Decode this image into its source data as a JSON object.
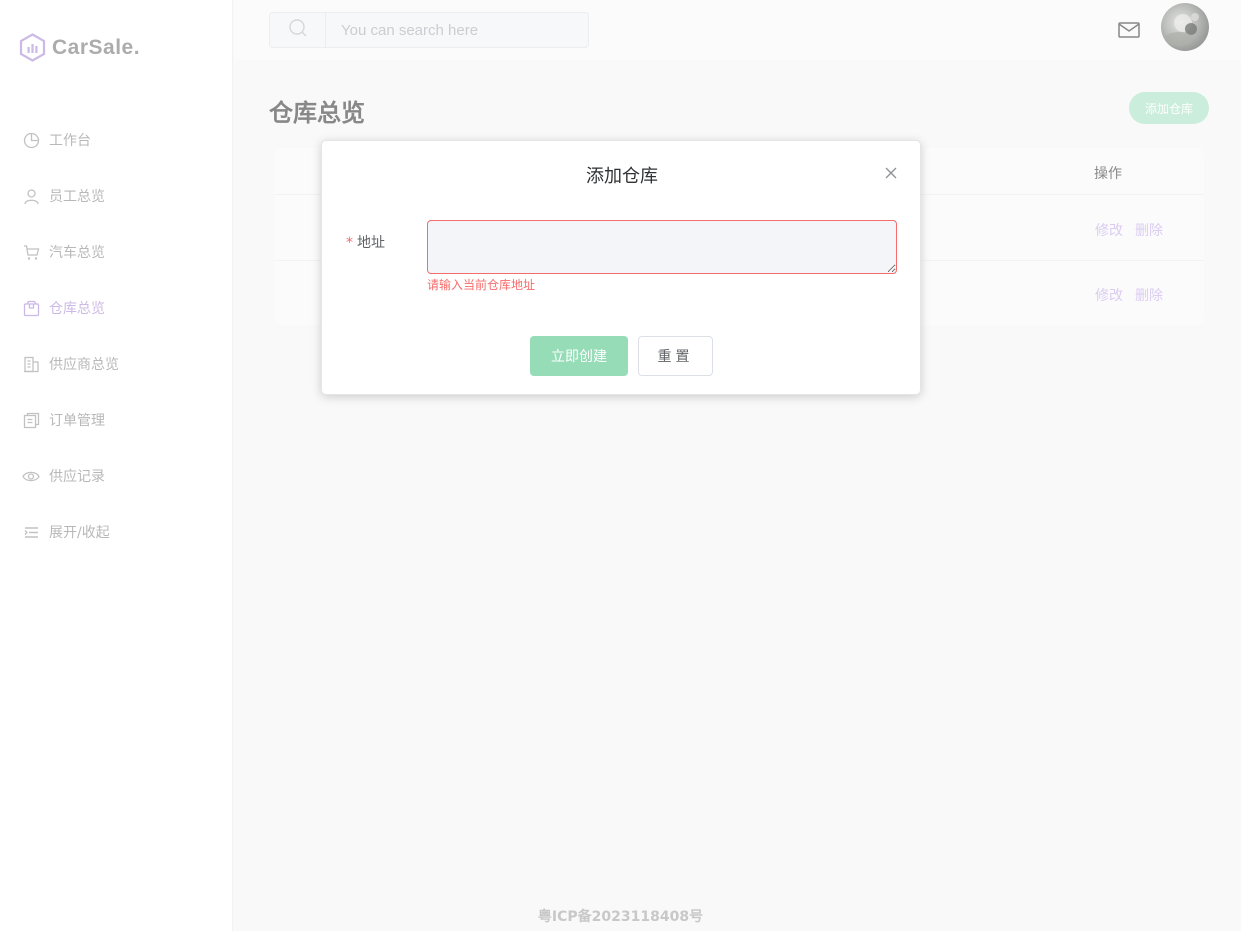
{
  "brand": {
    "name": "CarSale."
  },
  "header": {
    "search_placeholder": "You can search here"
  },
  "sidebar": {
    "items": [
      {
        "label": "工作台",
        "icon": "pie-chart-icon",
        "active": false
      },
      {
        "label": "员工总览",
        "icon": "user-icon",
        "active": false
      },
      {
        "label": "汽车总览",
        "icon": "cart-icon",
        "active": false
      },
      {
        "label": "仓库总览",
        "icon": "box-icon",
        "active": true
      },
      {
        "label": "供应商总览",
        "icon": "building-icon",
        "active": false
      },
      {
        "label": "订单管理",
        "icon": "document-icon",
        "active": false
      },
      {
        "label": "供应记录",
        "icon": "eye-icon",
        "active": false
      },
      {
        "label": "展开/收起",
        "icon": "menu-icon",
        "active": false
      }
    ]
  },
  "main": {
    "title": "仓库总览",
    "add_button": "添加仓库",
    "table": {
      "op_header": "操作",
      "rows": [
        {
          "edit": "修改",
          "delete": "删除"
        },
        {
          "edit": "修改",
          "delete": "删除"
        }
      ]
    }
  },
  "dialog": {
    "title": "添加仓库",
    "field_label": "地址",
    "required_mark": "*",
    "error": "请输入当前仓库地址",
    "create_button": "立即创建",
    "reset_button": "重置"
  },
  "footer": {
    "icp": "粤ICP备2023118408号"
  },
  "colors": {
    "accent": "#b79ddc",
    "green": "#95dcb7",
    "error": "#f56c6c"
  }
}
